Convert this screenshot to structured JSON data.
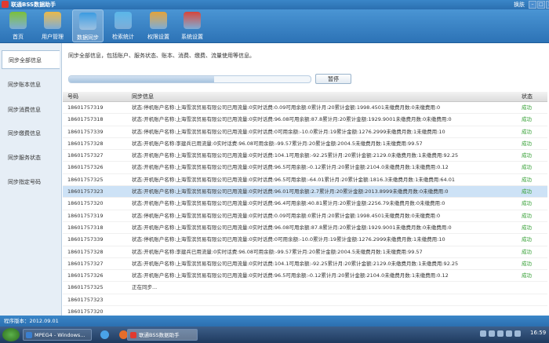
{
  "window": {
    "title": "联通BSS数据助手",
    "skin_label": "换肤",
    "buttons": [
      "–",
      "□",
      "×"
    ]
  },
  "toolbar": {
    "items": [
      {
        "name": "tool-home",
        "label": "首页",
        "icon": "home-icon",
        "color": "#7bbf3a"
      },
      {
        "name": "tool-user-manage",
        "label": "用户管理",
        "icon": "users-icon",
        "color": "#e9b84a"
      },
      {
        "name": "tool-data-sync",
        "label": "数据同步",
        "icon": "sync-icon",
        "color": "#3b9be0",
        "active": true
      },
      {
        "name": "tool-search-stats",
        "label": "检索统计",
        "icon": "monitor-icon",
        "color": "#5ab6e8"
      },
      {
        "name": "tool-permission",
        "label": "权限设置",
        "icon": "lock-icon",
        "color": "#e2a23b"
      },
      {
        "name": "tool-system",
        "label": "系统设置",
        "icon": "windows-icon",
        "color": "#d6453a"
      }
    ]
  },
  "sidebar": {
    "items": [
      {
        "label": "同步全部信息",
        "active": true
      },
      {
        "label": "同步账本信息"
      },
      {
        "label": "同步消费信息"
      },
      {
        "label": "同步缴费信息"
      },
      {
        "label": "同步服务状态"
      },
      {
        "label": "同步指定号码"
      }
    ]
  },
  "main": {
    "description": "同步全部信息，包括账户、服务状态、账本、消费、缴费、流量使用等信息。",
    "progress": 0.6,
    "pause_label": "暂停"
  },
  "table": {
    "headers": [
      "号码",
      "同步信息",
      "状态"
    ],
    "rows": [
      {
        "number": "18601757319",
        "info": "状态:停机账户名称:上海雪滨贸易有限公司已用流量:0实时话费:0.09可用余额:0累计月:20累计金额:1998.4501未缴费月数:0未缴费用:0",
        "status": "成功"
      },
      {
        "number": "18601757318",
        "info": "状态:开机账户名称:上海雪滨贸易有限公司已用流量:0实时话费:96.08可用余额:87.8累计月:20累计金额:1929.9001未缴费月数:0未缴费用:0",
        "status": "成功"
      },
      {
        "number": "18601757339",
        "info": "状态:停机账户名称:上海雪滨贸易有限公司已用流量:0实时话费:0可用余额:-10.0累计月:19累计金额:1276.2999未缴费月数:1未缴费用:10",
        "status": "成功"
      },
      {
        "number": "18601757328",
        "info": "状态:开机账户名称:李建兵已用流量:0实时话费:96.08可用余额:-99.57累计月:20累计金额:2004.5未缴费月数:1未缴费用:99.57",
        "status": "成功"
      },
      {
        "number": "18601757327",
        "info": "状态:开机账户名称:上海雪滨贸易有限公司已用流量:0实时话费:104.1可用余额:-92.25累计月:20累计金额:2129.0未缴费月数:1未缴费用:92.25",
        "status": "成功"
      },
      {
        "number": "18601757326",
        "info": "状态:开机账户名称:上海雪滨贸易有限公司已用流量:0实时话费:96.5可用余额:-0.12累计月:20累计金额:2104.0未缴费月数:1未缴费用:0.12",
        "status": "成功"
      },
      {
        "number": "18601757325",
        "info": "状态:开机账户名称:上海雪滨贸易有限公司已用流量:0实时话费:96.5可用余额:-64.01累计月:20累计金额:1816.3未缴费月数:1未缴费用:64.01",
        "status": "成功"
      },
      {
        "number": "18601757323",
        "info": "状态:开机账户名称:上海雪滨贸易有限公司已用流量:0实时话费:96.01可用余额:2.7累计月:20累计金额:2013.8999未缴费月数:0未缴费用:0",
        "status": "成功",
        "selected": true
      },
      {
        "number": "18601757320",
        "info": "状态:开机账户名称:上海雪滨贸易有限公司已用流量:0实时话费:96.4可用余额:40.81累计月:20累计金额:2256.79未缴费月数:0未缴费用:0",
        "status": "成功"
      },
      {
        "number": "18601757319",
        "info": "状态:停机账户名称:上海雪滨贸易有限公司已用流量:0实时话费:0.09可用余额:0累计月:20累计金额:1998.4501未缴费月数:0未缴费用:0",
        "status": "成功"
      },
      {
        "number": "18601757318",
        "info": "状态:开机账户名称:上海雪滨贸易有限公司已用流量:0实时话费:96.08可用余额:87.8累计月:20累计金额:1929.9001未缴费月数:0未缴费用:0",
        "status": "成功"
      },
      {
        "number": "18601757339",
        "info": "状态:停机账户名称:上海雪滨贸易有限公司已用流量:0实时话费:0可用余额:-10.0累计月:19累计金额:1276.2999未缴费月数:1未缴费用:10",
        "status": "成功"
      },
      {
        "number": "18601757328",
        "info": "状态:开机账户名称:李建兵已用流量:0实时话费:96.08可用余额:-99.57累计月:20累计金额:2004.5未缴费月数:1未缴费用:99.57",
        "status": "成功"
      },
      {
        "number": "18601757327",
        "info": "状态:开机账户名称:上海雪滨贸易有限公司已用流量:0实时话费:104.1可用余额:-92.25累计月:20累计金额:2129.0未缴费月数:1未缴费用:92.25",
        "status": "成功"
      },
      {
        "number": "18601757326",
        "info": "状态:开机账户名称:上海雪滨贸易有限公司已用流量:0实时话费:96.5可用余额:-0.12累计月:20累计金额:2104.0未缴费月数:1未缴费用:0.12",
        "status": "成功"
      },
      {
        "number": "18601757325",
        "info": "正在同步...",
        "status": ""
      },
      {
        "number": "18601757323",
        "info": "",
        "status": ""
      },
      {
        "number": "18601757320",
        "info": "",
        "status": ""
      }
    ]
  },
  "statusbar": {
    "version": "程序版本：2012.09.01"
  },
  "taskbar": {
    "tasks": [
      {
        "label": "MPEG4 - Windows...",
        "color": "#3a7fd0"
      },
      {
        "label": "联通BSS数据助手",
        "color": "#e03a2f",
        "active": true
      }
    ],
    "clock": "16:59"
  }
}
